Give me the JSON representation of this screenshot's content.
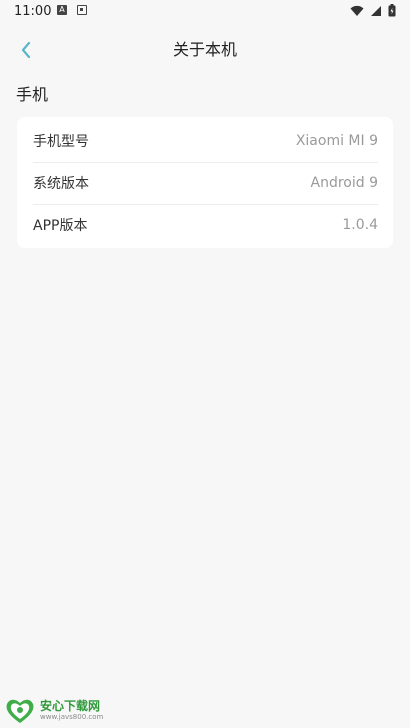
{
  "status_bar": {
    "time": "11:00",
    "icons": [
      "a-notification-icon",
      "image-notification-icon",
      "wifi-icon",
      "signal-icon",
      "battery-icon"
    ]
  },
  "header": {
    "title": "关于本机",
    "back_icon": "chevron-left-icon",
    "accent_color": "#5bb5c9"
  },
  "section": {
    "title": "手机"
  },
  "info": {
    "rows": [
      {
        "label": "手机型号",
        "value": "Xiaomi MI 9"
      },
      {
        "label": "系统版本",
        "value": "Android 9"
      },
      {
        "label": "APP版本",
        "value": "1.0.4"
      }
    ]
  },
  "watermark": {
    "name": "安心下载网",
    "url": "www.javs800.com"
  }
}
